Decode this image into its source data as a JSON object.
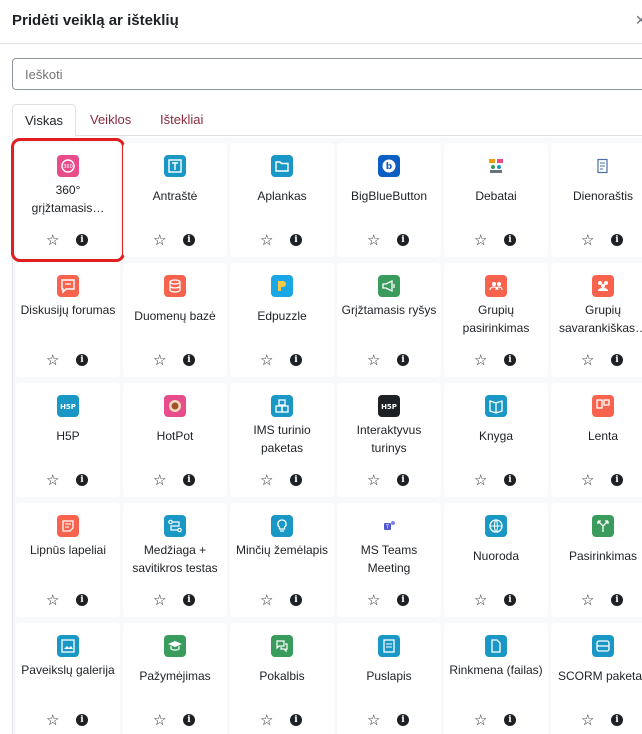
{
  "dialog": {
    "title": "Pridėti veiklą ar išteklių",
    "close": "×"
  },
  "search": {
    "placeholder": "Ieškoti"
  },
  "tabs": [
    {
      "label": "Viskas",
      "active": true
    },
    {
      "label": "Veiklos",
      "active": false
    },
    {
      "label": "Ištekliai",
      "active": false
    }
  ],
  "actions": {
    "star": "☆",
    "info": "i"
  },
  "items": [
    {
      "name": "360° grįžtamasis…",
      "icon": "360-feedback-icon",
      "color": "#e84c8b",
      "selected": true
    },
    {
      "name": "Antraštė",
      "icon": "text-label-icon",
      "color": "#1998c6"
    },
    {
      "name": "Aplankas",
      "icon": "folder-icon",
      "color": "#1998c6"
    },
    {
      "name": "BigBlueButton",
      "icon": "bigbluebutton-icon",
      "color": "#0d5ec2"
    },
    {
      "name": "Debatai",
      "icon": "debate-icon",
      "color": "#ffffff"
    },
    {
      "name": "Dienoraštis",
      "icon": "journal-icon",
      "color": "#ffffff"
    },
    {
      "name": "Diskusijų forumas",
      "icon": "forum-icon",
      "color": "#f7634d"
    },
    {
      "name": "Duomenų bazė",
      "icon": "database-icon",
      "color": "#f7634d"
    },
    {
      "name": "Edpuzzle",
      "icon": "edpuzzle-icon",
      "color": "#1ba7e6"
    },
    {
      "name": "Grįžtamasis ryšys",
      "icon": "feedback-megaphone-icon",
      "color": "#399b5c"
    },
    {
      "name": "Grupių pasirinkimas",
      "icon": "group-choice-icon",
      "color": "#f7634d"
    },
    {
      "name": "Grupių savarankiškas…",
      "icon": "group-self-selection-icon",
      "color": "#f7634d"
    },
    {
      "name": "H5P",
      "icon": "h5p-icon",
      "color": "#1998c6"
    },
    {
      "name": "HotPot",
      "icon": "hotpot-icon",
      "color": "#e84c8b"
    },
    {
      "name": "IMS turinio paketas",
      "icon": "ims-package-icon",
      "color": "#1998c6"
    },
    {
      "name": "Interaktyvus turinys",
      "icon": "interactive-content-icon",
      "color": "#1d2125"
    },
    {
      "name": "Knyga",
      "icon": "book-icon",
      "color": "#1998c6"
    },
    {
      "name": "Lenta",
      "icon": "board-icon",
      "color": "#f7634d"
    },
    {
      "name": "Lipnūs lapeliai",
      "icon": "sticky-notes-icon",
      "color": "#f7634d"
    },
    {
      "name": "Medžiaga + savitikros testas",
      "icon": "lesson-icon",
      "color": "#1998c6"
    },
    {
      "name": "Minčių žemėlapis",
      "icon": "mindmap-icon",
      "color": "#1998c6"
    },
    {
      "name": "MS Teams Meeting",
      "icon": "ms-teams-icon",
      "color": "#ffffff"
    },
    {
      "name": "Nuoroda",
      "icon": "url-globe-icon",
      "color": "#1998c6"
    },
    {
      "name": "Pasirinkimas",
      "icon": "choice-icon",
      "color": "#399b5c"
    },
    {
      "name": "Paveikslų galerija",
      "icon": "image-gallery-icon",
      "color": "#1998c6"
    },
    {
      "name": "Pažymėjimas",
      "icon": "certificate-icon",
      "color": "#399b5c"
    },
    {
      "name": "Pokalbis",
      "icon": "chat-icon",
      "color": "#399b5c"
    },
    {
      "name": "Puslapis",
      "icon": "page-icon",
      "color": "#1998c6"
    },
    {
      "name": "Rinkmena (failas)",
      "icon": "file-icon",
      "color": "#1998c6"
    },
    {
      "name": "SCORM paketas",
      "icon": "scorm-icon",
      "color": "#1998c6"
    }
  ]
}
